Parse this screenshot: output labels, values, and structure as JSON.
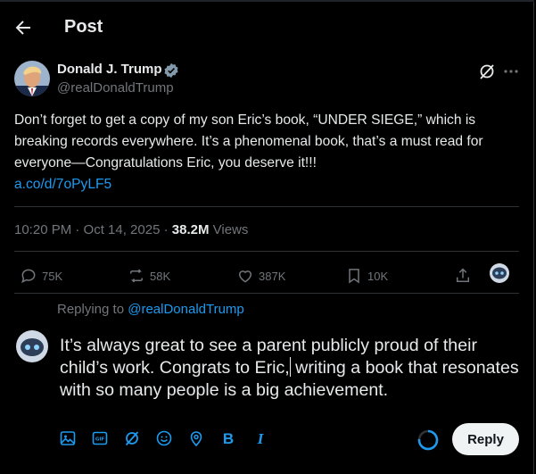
{
  "header": {
    "title": "Post"
  },
  "post": {
    "author_name": "Donald J. Trump",
    "author_handle": "@realDonaldTrump",
    "text": "Don’t forget to get a copy of my son Eric’s book, “UNDER SIEGE,” which is breaking records everywhere. It’s a phenomenal book, that’s a must read for everyone—Congratulations Eric, you deserve it!!!",
    "link": "a.co/d/7oPyLF5",
    "timestamp": "10:20 PM · Oct 14, 2025 · ",
    "views_count": "38.2M",
    "views_label": " Views"
  },
  "stats": {
    "replies": "75K",
    "reposts": "58K",
    "likes": "387K",
    "bookmarks": "10K"
  },
  "reply": {
    "context_prefix": "Replying to ",
    "context_handle": "@realDonaldTrump",
    "text_before_caret": "It’s always great to see a parent publicly proud of their child’s work. Congrats to Eric,",
    "text_after_caret": " writing a book that resonates with so many people is a big achievement.",
    "button_label": "Reply"
  },
  "colors": {
    "accent": "#1d9bf0",
    "background": "#000000",
    "muted": "#71767b",
    "text": "#e7e9ea"
  }
}
